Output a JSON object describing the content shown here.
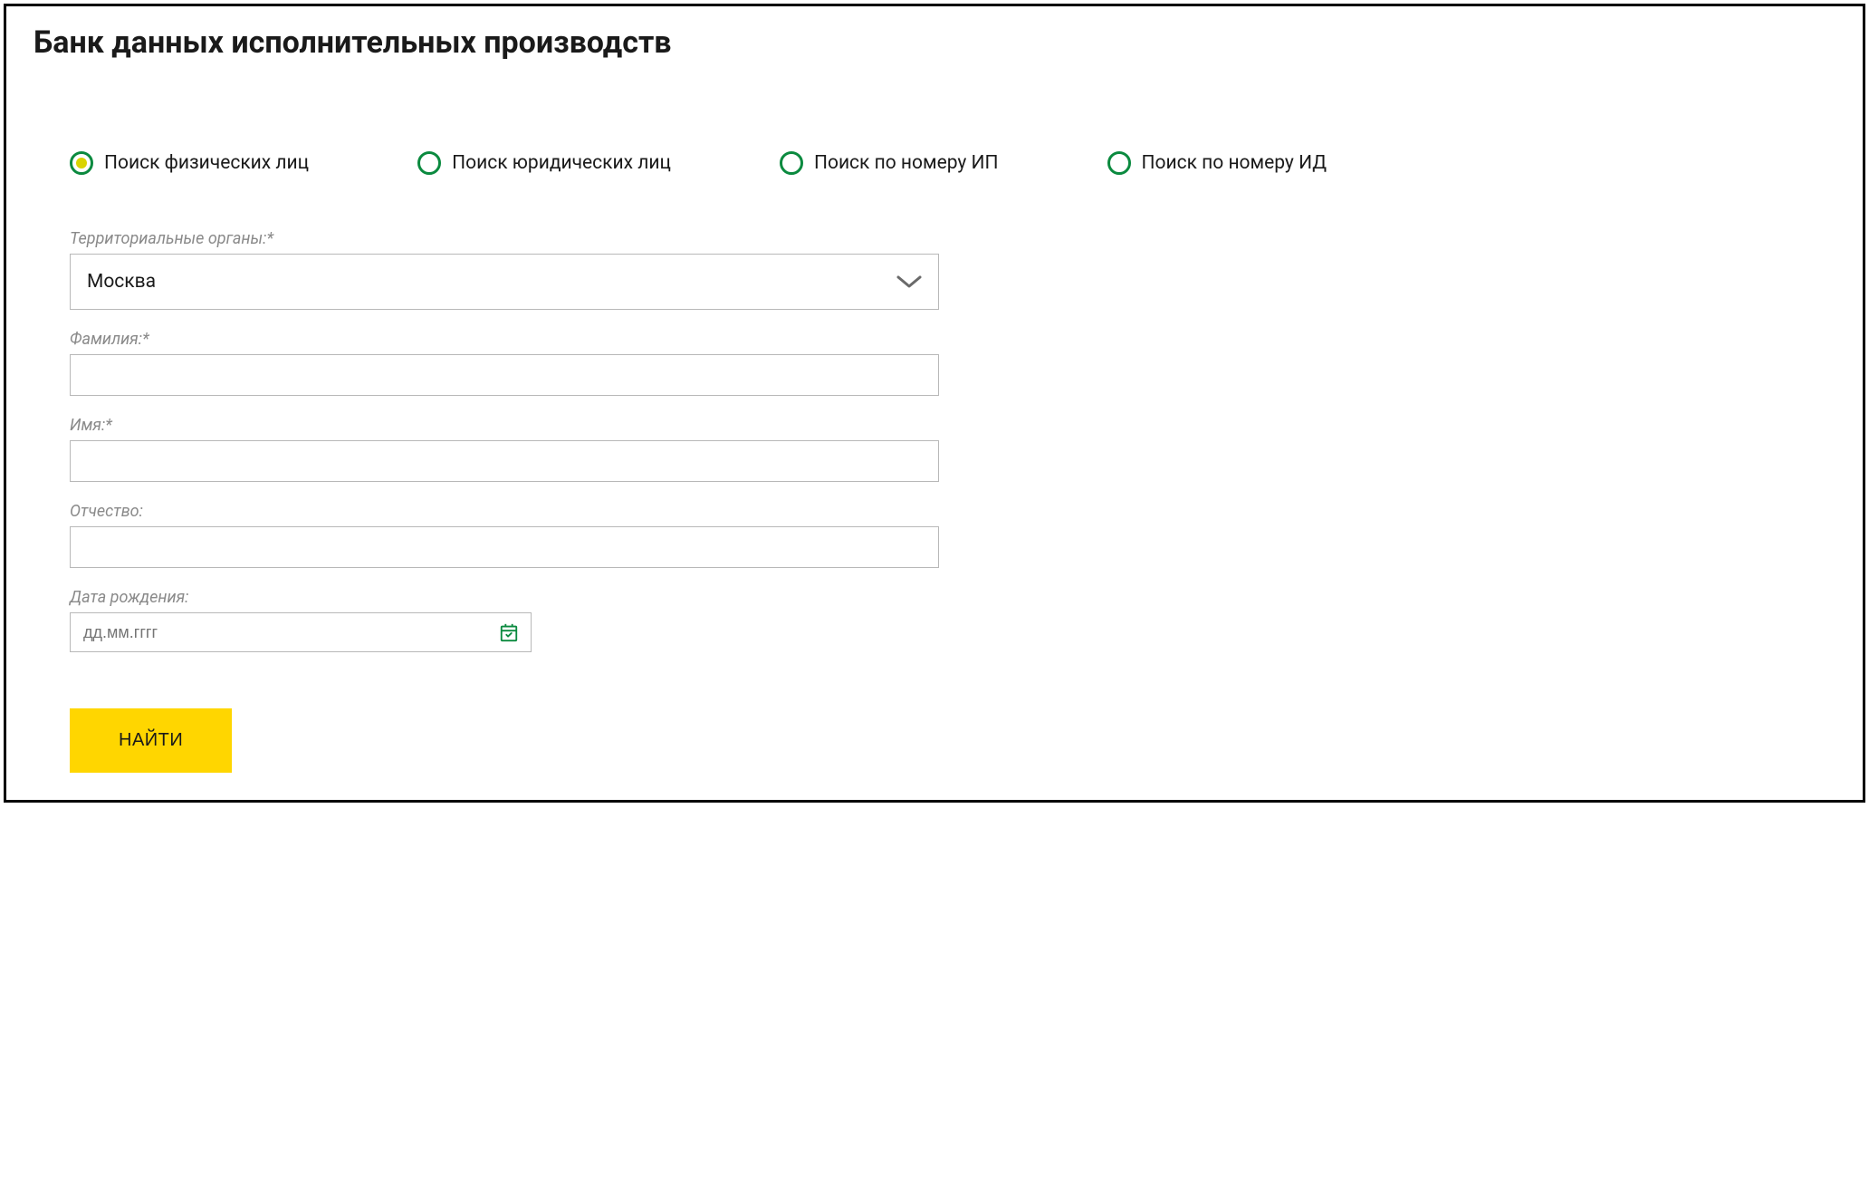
{
  "title": "Банк данных исполнительных производств",
  "radios": {
    "physical": "Поиск физических лиц",
    "legal": "Поиск юридических лиц",
    "ip_number": "Поиск по номеру ИП",
    "id_number": "Поиск по номеру ИД"
  },
  "form": {
    "territory": {
      "label": "Территориальные органы:*",
      "value": "Москва"
    },
    "surname": {
      "label": "Фамилия:*",
      "value": ""
    },
    "firstname": {
      "label": "Имя:*",
      "value": ""
    },
    "patronymic": {
      "label": "Отчество:",
      "value": ""
    },
    "birthdate": {
      "label": "Дата рождения:",
      "placeholder": "дд.мм.гггг"
    }
  },
  "submit_label": "НАЙТИ"
}
